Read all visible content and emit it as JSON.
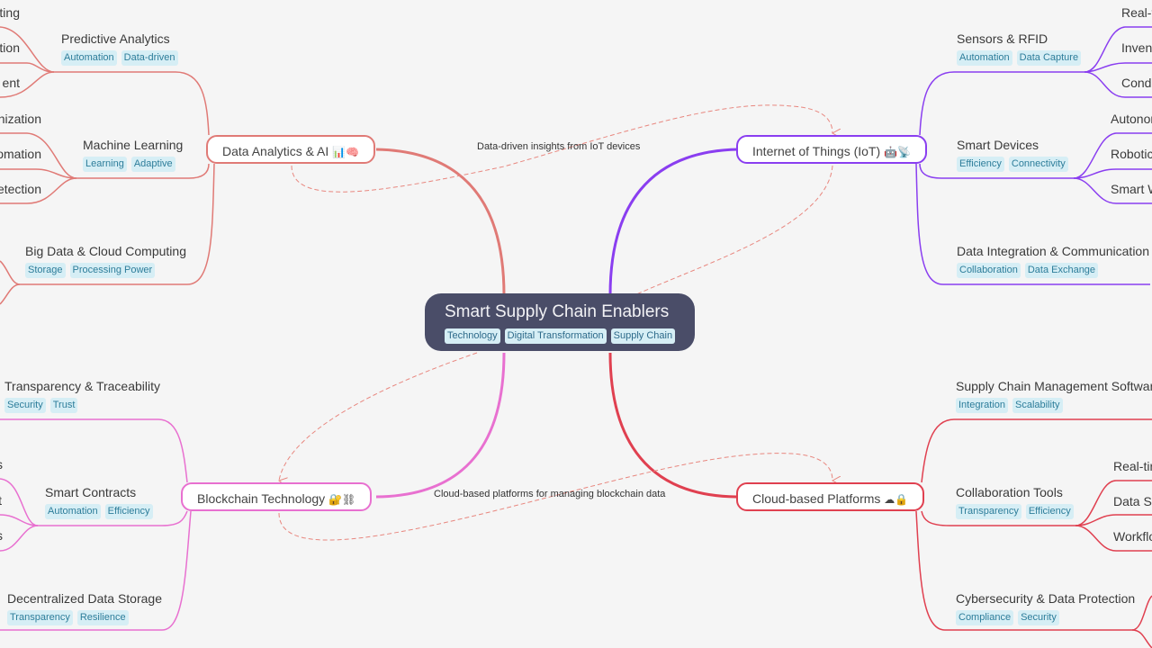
{
  "root": {
    "title": "Smart Supply Chain Enablers",
    "tags": [
      "Technology",
      "Digital Transformation",
      "Supply Chain"
    ]
  },
  "colors": {
    "background": "#f5f5f5",
    "root_fill": "#4a4d68",
    "analytics": "#e07a76",
    "iot": "#8a3ef0",
    "blockchain": "#e870d0",
    "cloud": "#e04050",
    "tag_bg": "#d6eef5",
    "tag_text": "#2d7d9a"
  },
  "branches": {
    "analytics": {
      "label": "Data Analytics & AI",
      "icons": "📊🧠",
      "children": [
        {
          "label": "Predictive Analytics",
          "tags": [
            "Automation",
            "Data-driven"
          ],
          "leaves": [
            "ting",
            "tion",
            "ent"
          ]
        },
        {
          "label": "Machine Learning",
          "tags": [
            "Learning",
            "Adaptive"
          ],
          "leaves": [
            "nization",
            "omation",
            "etection"
          ]
        },
        {
          "label": "Big Data & Cloud Computing",
          "tags": [
            "Storage",
            "Processing Power"
          ],
          "leaves": []
        }
      ]
    },
    "iot": {
      "label": "Internet of Things (IoT)",
      "icons": "🤖📡",
      "children": [
        {
          "label": "Sensors & RFID",
          "tags": [
            "Automation",
            "Data Capture"
          ],
          "leaves": [
            "Real-t",
            "Inven",
            "Condi"
          ]
        },
        {
          "label": "Smart Devices",
          "tags": [
            "Efficiency",
            "Connectivity"
          ],
          "leaves": [
            "Autonor",
            "Robotic",
            "Smart W"
          ]
        },
        {
          "label": "Data Integration & Communication",
          "tags": [
            "Collaboration",
            "Data Exchange"
          ],
          "leaves": []
        }
      ]
    },
    "blockchain": {
      "label": "Blockchain Technology",
      "icons": "🔐⛓",
      "children": [
        {
          "label": "Transparency & Traceability",
          "tags": [
            "Security",
            "Trust"
          ],
          "leaves": []
        },
        {
          "label": "Smart Contracts",
          "tags": [
            "Automation",
            "Efficiency"
          ],
          "leaves": [
            "s",
            "t",
            "s"
          ]
        },
        {
          "label": "Decentralized Data Storage",
          "tags": [
            "Transparency",
            "Resilience"
          ],
          "leaves": []
        }
      ]
    },
    "cloud": {
      "label": "Cloud-based Platforms",
      "icons": "☁🔒",
      "children": [
        {
          "label": "Supply Chain Management Software",
          "tags": [
            "Integration",
            "Scalability"
          ],
          "leaves": []
        },
        {
          "label": "Collaboration Tools",
          "tags": [
            "Transparency",
            "Efficiency"
          ],
          "leaves": [
            "Real-tir",
            "Data Sh",
            "Workflo"
          ]
        },
        {
          "label": "Cybersecurity & Data Protection",
          "tags": [
            "Compliance",
            "Security"
          ],
          "leaves": []
        }
      ]
    }
  },
  "links": [
    {
      "label": "Data-driven insights from IoT devices",
      "from": "Data Analytics & AI",
      "to": "Internet of Things (IoT)"
    },
    {
      "label": "Cloud-based platforms for managing blockchain data",
      "from": "Blockchain Technology",
      "to": "Cloud-based Platforms"
    }
  ]
}
